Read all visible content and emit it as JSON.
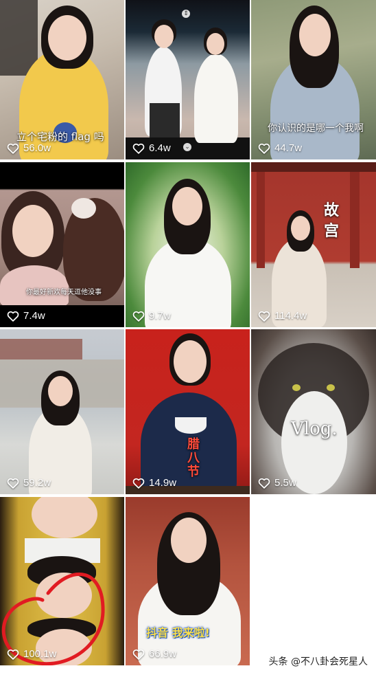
{
  "feed": {
    "tiles": [
      {
        "likes": "56.0w",
        "caption": "立个宅粉的 flag 吗"
      },
      {
        "likes": "6.4w"
      },
      {
        "likes": "44.7w",
        "caption": "你认识的是哪一个我啊"
      },
      {
        "likes": "7.4w",
        "caption": "你最好新欢每天逗他没事"
      },
      {
        "likes": "9.7w"
      },
      {
        "likes": "114.4w",
        "caption": "故宫"
      },
      {
        "likes": "59.2w"
      },
      {
        "likes": "14.9w",
        "caption": "腊八节"
      },
      {
        "likes": "5.5w",
        "caption": "Vlog."
      },
      {
        "likes": "100.1w"
      },
      {
        "likes": "66.9w",
        "caption": "抖音 我来啦!"
      }
    ]
  },
  "watermark": "头条 @不八卦会死星人",
  "icons": {
    "like": "heart-outline-icon"
  },
  "colors": {
    "annotation_circle": "#e11b22",
    "page_background": "#ffffff"
  }
}
